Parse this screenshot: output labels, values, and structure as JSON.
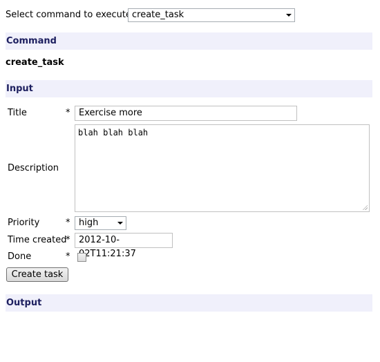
{
  "command_selector": {
    "label": "Select command to execute",
    "selected": "create_task"
  },
  "sections": {
    "command": "Command",
    "input": "Input",
    "output": "Output"
  },
  "command_name": "create_task",
  "form": {
    "required_marker": "*",
    "title": {
      "label": "Title",
      "value": "Exercise more"
    },
    "description": {
      "label": "Description",
      "value": "blah blah blah"
    },
    "priority": {
      "label": "Priority",
      "selected": "high"
    },
    "time_created": {
      "label": "Time created",
      "value": "2012-10-02T11:21:37"
    },
    "done": {
      "label": "Done",
      "checked": false
    },
    "submit_label": "Create task"
  },
  "colors": {
    "section_bg": "#f0f0fb",
    "section_text": "#1e2060"
  }
}
